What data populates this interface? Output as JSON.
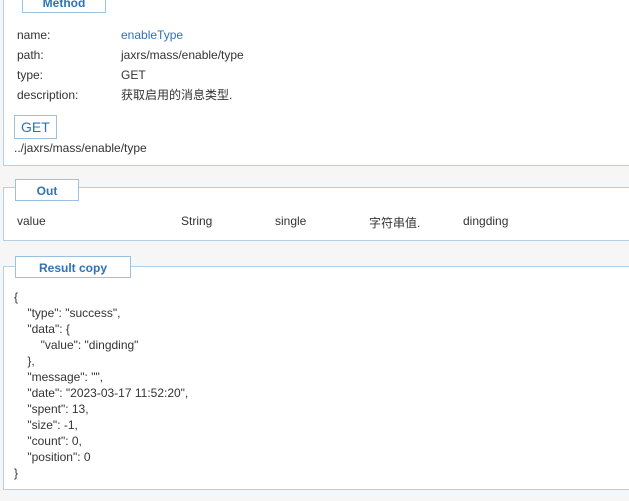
{
  "method": {
    "legend": "Method",
    "fields": [
      {
        "key": "name:",
        "value": "enableType"
      },
      {
        "key": "path:",
        "value": "jaxrs/mass/enable/type"
      },
      {
        "key": "type:",
        "value": "GET"
      },
      {
        "key": "description:",
        "value": "获取启用的消息类型."
      }
    ],
    "http_method": "GET",
    "url": "../jaxrs/mass/enable/type"
  },
  "out": {
    "legend": "Out",
    "row": {
      "name": "value",
      "type": "String",
      "multiplicity": "single",
      "description": "字符串值.",
      "example": "dingding"
    }
  },
  "result": {
    "legend": "Result copy",
    "code": "{\n    \"type\": \"success\",\n    \"data\": {\n        \"value\": \"dingding\"\n    },\n    \"message\": \"\",\n    \"date\": \"2023-03-17 11:52:20\",\n    \"spent\": 13,\n    \"size\": -1,\n    \"count\": 0,\n    \"position\": 0\n}"
  },
  "colors": {
    "accent": "#2f73b4",
    "border": "#b4d0e6",
    "background": "#f6f6f6"
  }
}
